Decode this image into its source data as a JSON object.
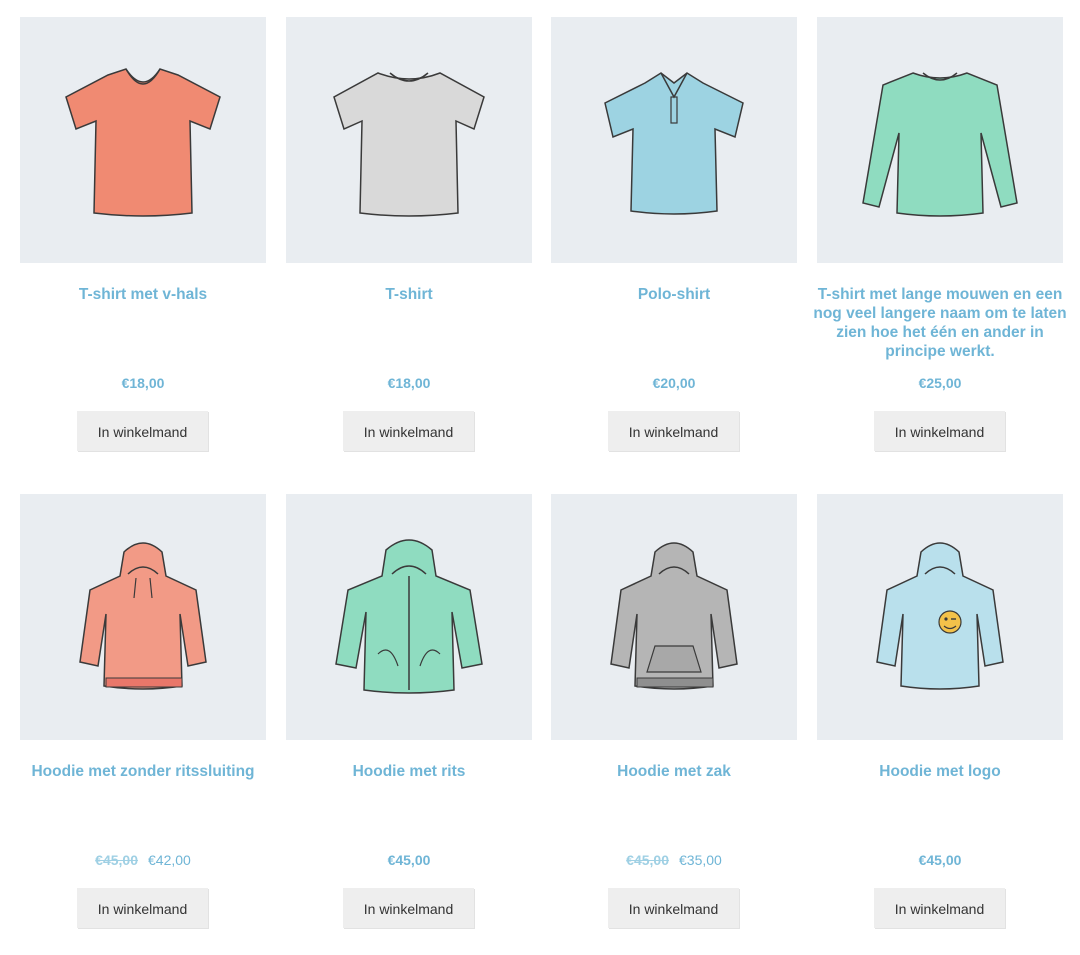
{
  "products": [
    {
      "title": "T-shirt met v-hals",
      "price": "€18,00",
      "old_price": "",
      "new_price": "",
      "button": "In winkelmand",
      "icon": "vneck-tshirt-icon",
      "color": "#f08a72"
    },
    {
      "title": "T-shirt",
      "price": "€18,00",
      "old_price": "",
      "new_price": "",
      "button": "In winkelmand",
      "icon": "tshirt-icon",
      "color": "#d9d9d9"
    },
    {
      "title": "Polo-shirt",
      "price": "€20,00",
      "old_price": "",
      "new_price": "",
      "button": "In winkelmand",
      "icon": "polo-shirt-icon",
      "color": "#9dd3e2"
    },
    {
      "title": "T-shirt met lange mouwen en een nog veel langere naam om te laten zien hoe het één en ander in principe werkt.",
      "price": "€25,00",
      "old_price": "",
      "new_price": "",
      "button": "In winkelmand",
      "icon": "longsleeve-shirt-icon",
      "color": "#8fdcc0"
    },
    {
      "title": "Hoodie met zonder ritssluiting",
      "price": "",
      "old_price": "€45,00",
      "new_price": "€42,00",
      "button": "In winkelmand",
      "icon": "hoodie-icon",
      "color": "#f29a86"
    },
    {
      "title": "Hoodie met rits",
      "price": "€45,00",
      "old_price": "",
      "new_price": "",
      "button": "In winkelmand",
      "icon": "zip-hoodie-icon",
      "color": "#8fdcc0"
    },
    {
      "title": "Hoodie met zak",
      "price": "",
      "old_price": "€45,00",
      "new_price": "€35,00",
      "button": "In winkelmand",
      "icon": "pocket-hoodie-icon",
      "color": "#b5b5b5"
    },
    {
      "title": "Hoodie met logo",
      "price": "€45,00",
      "old_price": "",
      "new_price": "",
      "button": "In winkelmand",
      "icon": "logo-hoodie-icon",
      "color": "#b9e0ec"
    }
  ]
}
